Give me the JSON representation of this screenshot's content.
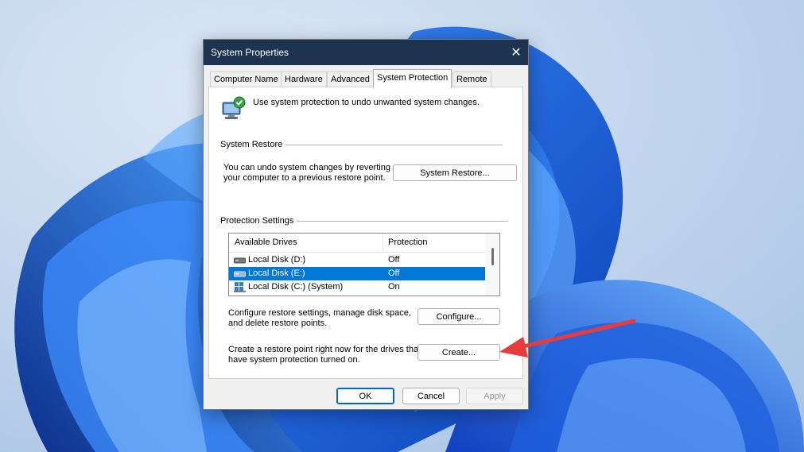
{
  "dialog": {
    "title": "System Properties",
    "close_glyph": "✕",
    "tabs": [
      {
        "label": "Computer Name"
      },
      {
        "label": "Hardware"
      },
      {
        "label": "Advanced"
      },
      {
        "label": "System Protection",
        "active": true
      },
      {
        "label": "Remote"
      }
    ],
    "intro_text": "Use system protection to undo unwanted system changes.",
    "system_restore": {
      "group_label": "System Restore",
      "description_line1": "You can undo system changes by reverting",
      "description_line2": "your computer to a previous restore point.",
      "button_label": "System Restore..."
    },
    "protection_settings": {
      "group_label": "Protection Settings",
      "columns": [
        "Available Drives",
        "Protection"
      ],
      "drives": [
        {
          "name": "Local Disk (D:)",
          "protection": "Off",
          "selected": false,
          "icon": "drive-icon"
        },
        {
          "name": "Local Disk (E:)",
          "protection": "Off",
          "selected": true,
          "icon": "drive-icon"
        },
        {
          "name": "Local Disk (C:) (System)",
          "protection": "On",
          "selected": false,
          "icon": "system-drive-icon"
        }
      ],
      "configure_text_line1": "Configure restore settings, manage disk space,",
      "configure_text_line2": "and delete restore points.",
      "configure_button": "Configure...",
      "create_text_line1": "Create a restore point right now for the drives that",
      "create_text_line2": "have system protection turned on.",
      "create_button": "Create..."
    },
    "footer": {
      "ok_label": "OK",
      "cancel_label": "Cancel",
      "apply_label": "Apply"
    }
  },
  "colors": {
    "accent": "#0067c0",
    "selection": "#0078d7",
    "annotation_arrow": "#e83c3c",
    "titlebar": "#1e3350"
  }
}
